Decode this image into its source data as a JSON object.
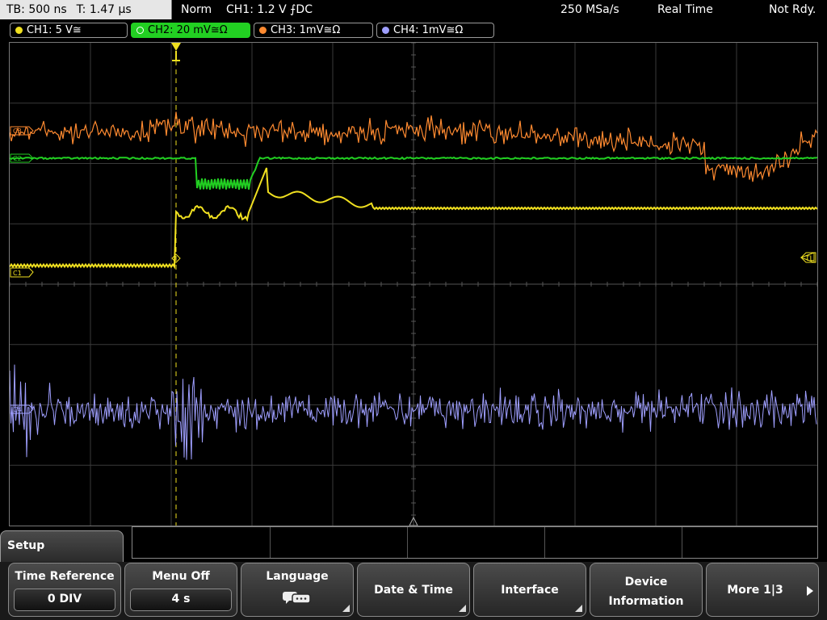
{
  "topbar": {
    "timebase": "TB: 500 ns",
    "trigger_time": "T: 1.47 µs",
    "mode": "Norm",
    "trigger_setting": "CH1: 1.2 V ⨍DC",
    "sample_rate": "250 MSa/s",
    "acq_mode": "Real Time",
    "status": "Not Rdy."
  },
  "channels": [
    {
      "label": "CH1: 5 V≅",
      "color": "#f0e020",
      "active": false
    },
    {
      "label": "CH2: 20 mV≅Ω",
      "color": "#22d022",
      "active": true
    },
    {
      "label": "CH3: 1mV≅Ω",
      "color": "#ff8a30",
      "active": false
    },
    {
      "label": "CH4: 1mV≅Ω",
      "color": "#9f9fff",
      "active": false
    }
  ],
  "markers": {
    "trigger_level": "TL",
    "ch1": "C1",
    "ch2": "C2",
    "ch3": "C3",
    "ch4": "C4"
  },
  "menu": {
    "title": "Setup",
    "softkeys": [
      {
        "label": "Time Reference",
        "value": "0 DIV"
      },
      {
        "label": "Menu Off",
        "value": "4 s"
      },
      {
        "label": "Language",
        "icon": "speech-bubble-icon"
      },
      {
        "label": "Date & Time"
      },
      {
        "label": "Interface"
      },
      {
        "label": "Device",
        "label2": "Information"
      },
      {
        "label": "More 1|3"
      }
    ]
  },
  "colors": {
    "ch1": "#f0e020",
    "ch2": "#22d022",
    "ch3": "#ff8a30",
    "ch4": "#9f9fff"
  }
}
